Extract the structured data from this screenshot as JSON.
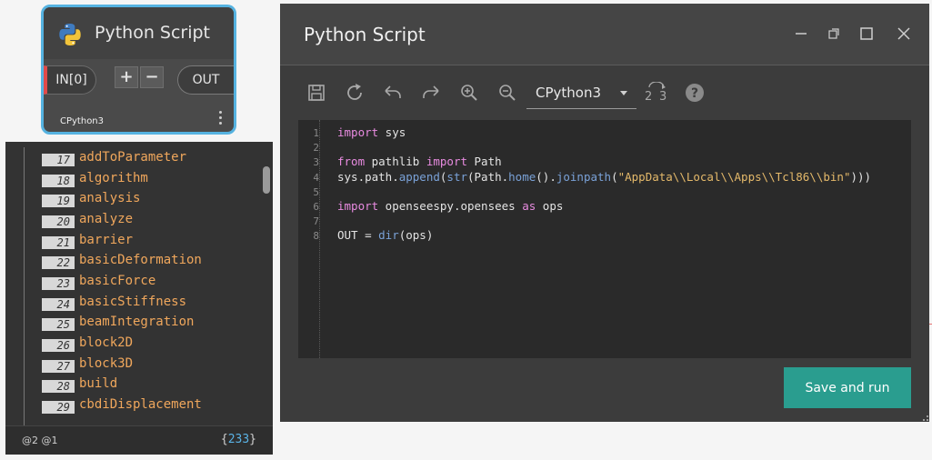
{
  "node": {
    "title": "Python Script",
    "input_port": "IN[0]",
    "add_label": "+",
    "remove_label": "−",
    "output_port": "OUT",
    "engine": "CPython3"
  },
  "preview": {
    "items": [
      {
        "index": "17",
        "value": "addToParameter"
      },
      {
        "index": "18",
        "value": "algorithm"
      },
      {
        "index": "19",
        "value": "analysis"
      },
      {
        "index": "20",
        "value": "analyze"
      },
      {
        "index": "21",
        "value": "barrier"
      },
      {
        "index": "22",
        "value": "basicDeformation"
      },
      {
        "index": "23",
        "value": "basicForce"
      },
      {
        "index": "24",
        "value": "basicStiffness"
      },
      {
        "index": "25",
        "value": "beamIntegration"
      },
      {
        "index": "26",
        "value": "block2D"
      },
      {
        "index": "27",
        "value": "block3D"
      },
      {
        "index": "28",
        "value": "build"
      },
      {
        "index": "29",
        "value": "cbdiDisplacement"
      }
    ],
    "levels": "@2 @1",
    "count_open": "{",
    "count": "233",
    "count_close": "}"
  },
  "editor": {
    "title": "Python Script",
    "engine": "CPython3",
    "save_run_label": "Save and run",
    "line_numbers": [
      "1",
      "2",
      "3",
      "4",
      "5",
      "6",
      "7",
      "8"
    ],
    "code": {
      "l1_kw": "import",
      "l1_rest": " sys",
      "l3_kw1": "from",
      "l3_mid": " pathlib ",
      "l3_kw2": "import",
      "l3_rest": " Path",
      "l4_a": "sys.path.",
      "l4_fn1": "append",
      "l4_b": "(",
      "l4_fn2": "str",
      "l4_c": "(Path.",
      "l4_fn3": "home",
      "l4_d": "().",
      "l4_fn4": "joinpath",
      "l4_e": "(",
      "l4_str": "\"AppData\\\\Local\\\\Apps\\\\Tcl86\\\\bin\"",
      "l4_f": ")))",
      "l6_kw1": "import",
      "l6_mid": " openseespy.opensees ",
      "l6_kw2": "as",
      "l6_rest": " ops",
      "l8_a": "OUT = ",
      "l8_fn": "dir",
      "l8_b": "(ops)"
    },
    "engine_version_label_a": "2",
    "engine_version_label_b": "3"
  },
  "icons": [
    "python-logo-icon",
    "save-icon",
    "run-icon",
    "undo-icon",
    "redo-icon",
    "zoom-in-icon",
    "zoom-out-icon",
    "convert-2to3-icon",
    "help-icon",
    "minimize-icon",
    "restore-icon",
    "maximize-icon",
    "close-icon"
  ],
  "colors": {
    "accent": "#2a9d8f",
    "node_border": "#55b2e0",
    "list_value": "#f0a75c",
    "keyword": "#e88be0",
    "function": "#7aa2d8",
    "string": "#e4b96a"
  }
}
